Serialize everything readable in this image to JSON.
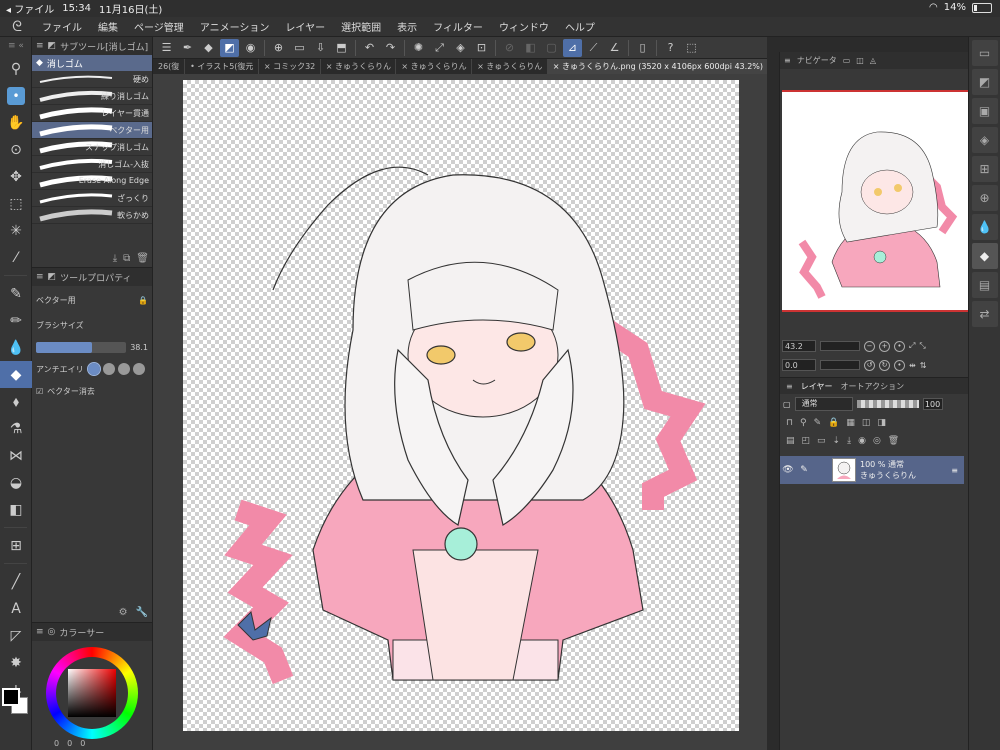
{
  "status": {
    "back_app": "◂ ファイル",
    "time": "15:34",
    "date": "11月16日(土)",
    "battery": "14%"
  },
  "menu": {
    "items": [
      "ファイル",
      "編集",
      "ページ管理",
      "アニメーション",
      "レイヤー",
      "選択範囲",
      "表示",
      "フィルター",
      "ウィンドウ",
      "ヘルプ"
    ]
  },
  "tabs": [
    {
      "label": "26(復"
    },
    {
      "label": "• イラスト5(復元"
    },
    {
      "label": "× コミック32"
    },
    {
      "label": "× きゅうくらりん"
    },
    {
      "label": "× きゅうくらりん"
    },
    {
      "label": "× きゅうくらりん"
    },
    {
      "label": "× きゅうくらりん.png (3520 x 4106px 600dpi 43.2%)",
      "active": true
    }
  ],
  "subtool": {
    "panel_title": "サブツール[消しゴム]",
    "group": "消しゴム",
    "brushes": [
      {
        "label": "硬め"
      },
      {
        "label": "練り消しゴム"
      },
      {
        "label": "レイヤー貫通"
      },
      {
        "label": "ベクター用",
        "selected": true
      },
      {
        "label": "スナップ消しゴム"
      },
      {
        "label": "消しゴム-入抜"
      },
      {
        "label": "Erase Along Edge"
      },
      {
        "label": "ざっくり"
      },
      {
        "label": "軟らかめ"
      }
    ]
  },
  "toolprop": {
    "panel_title": "ツールプロパティ",
    "preset": "ベクター用",
    "brush_size_label": "ブラシサイズ",
    "brush_size_value": "38.1",
    "brush_size_fraction": 0.62,
    "antialias_label": "アンチエイリ",
    "vector_label": "ベクター消去"
  },
  "color": {
    "panel_title": "カラーサー",
    "r": "0",
    "g": "0",
    "b": "0"
  },
  "navigator": {
    "title": "ナビゲータ",
    "zoom": "43.2",
    "rotate": "0.0"
  },
  "layers": {
    "title": "レイヤー",
    "auto_action": "オートアクション",
    "blend_mode": "通常",
    "opacity": "100",
    "items": [
      {
        "info": "100 % 通常",
        "name": "きゅうくらりん"
      }
    ]
  },
  "colors": {
    "accent": "#4f6fa8",
    "selected_row": "#5a6a8c",
    "pink": "#f28aa8"
  }
}
